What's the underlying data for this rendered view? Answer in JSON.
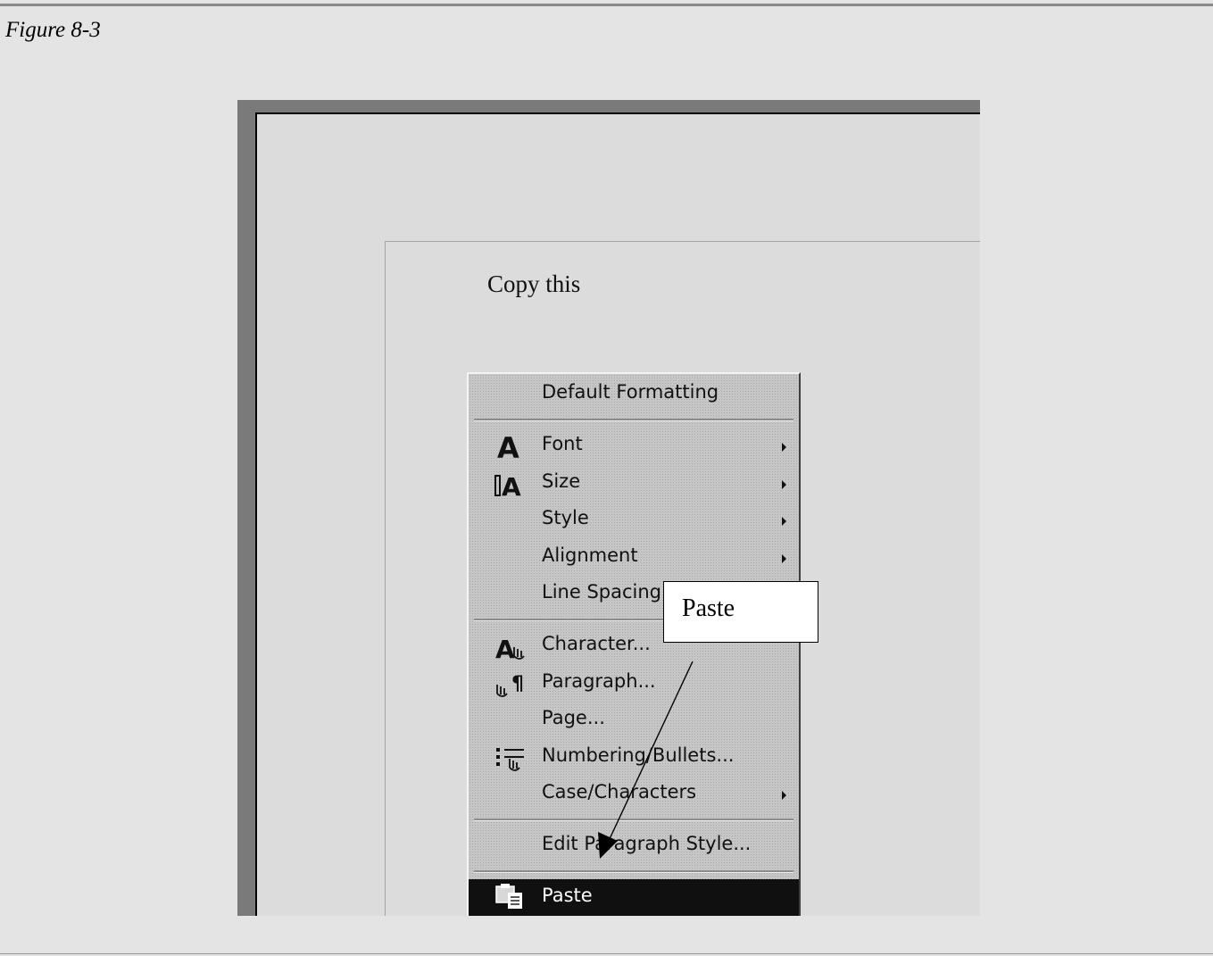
{
  "caption": "Figure 8-3",
  "document": {
    "text": "Copy this"
  },
  "context_menu": {
    "items": [
      {
        "label": "Default Formatting",
        "mnemonic": "D",
        "submenu": false,
        "icon": ""
      },
      {
        "label": "Font",
        "mnemonic": "F",
        "submenu": true,
        "icon": "font-icon"
      },
      {
        "label": "Size",
        "mnemonic": "S",
        "submenu": true,
        "icon": "font-size-icon"
      },
      {
        "label": "Style",
        "mnemonic": "y",
        "submenu": true,
        "icon": ""
      },
      {
        "label": "Alignment",
        "mnemonic": "i",
        "submenu": true,
        "icon": ""
      },
      {
        "label": "Line Spacing",
        "mnemonic": "i",
        "submenu": true,
        "icon": ""
      },
      {
        "label": "Character...",
        "mnemonic": "h",
        "submenu": false,
        "icon": "character-icon"
      },
      {
        "label": "Paragraph...",
        "mnemonic": "a",
        "submenu": false,
        "icon": "paragraph-icon"
      },
      {
        "label": "Page...",
        "mnemonic": "g",
        "submenu": false,
        "icon": ""
      },
      {
        "label": "Numbering/Bullets...",
        "mnemonic": "N",
        "submenu": false,
        "icon": "numbering-bullets-icon"
      },
      {
        "label": "Case/Characters",
        "mnemonic": "r",
        "submenu": true,
        "icon": ""
      },
      {
        "label": "Edit Paragraph Style...",
        "mnemonic": "E",
        "submenu": false,
        "icon": ""
      },
      {
        "label": "Paste",
        "mnemonic": "P",
        "submenu": false,
        "icon": "paste-icon",
        "highlighted": true
      }
    ]
  },
  "callout": {
    "text": "Paste"
  },
  "colors": {
    "menu_background": "#c6c6c6",
    "highlight": "#101010",
    "highlight_text": "#ffffff",
    "page_background": "#e4e4e4"
  }
}
